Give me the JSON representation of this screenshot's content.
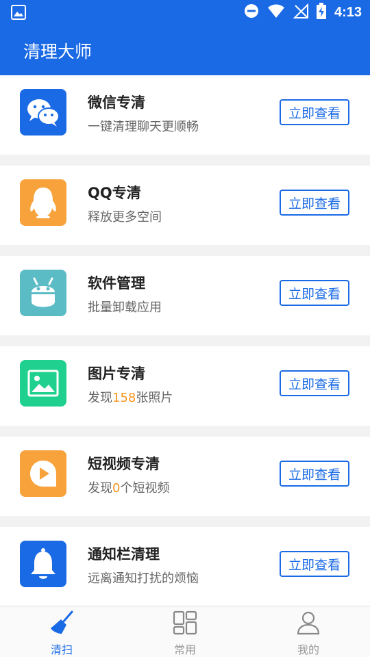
{
  "status_bar": {
    "time": "4:13"
  },
  "app": {
    "title": "清理大师"
  },
  "cards": [
    {
      "title": "微信专清",
      "sub": "一键清理聊天更顺畅",
      "button": "立即查看",
      "icon": "wechat-icon",
      "color": "#1a6ae6"
    },
    {
      "title": "QQ专清",
      "sub": "释放更多空间",
      "button": "立即查看",
      "icon": "qq-icon",
      "color": "#f7a23b"
    },
    {
      "title": "软件管理",
      "sub": "批量卸载应用",
      "button": "立即查看",
      "icon": "android-icon",
      "color": "#5bbcc6"
    },
    {
      "title": "图片专清",
      "sub_prefix": "发现",
      "sub_count": "158",
      "sub_suffix": "张照片",
      "button": "立即查看",
      "icon": "image-icon",
      "color": "#1fd08e"
    },
    {
      "title": "短视频专清",
      "sub_prefix": "发现",
      "sub_count": "0",
      "sub_suffix": "个短视频",
      "button": "立即查看",
      "icon": "video-play-icon",
      "color": "#f7a23b"
    },
    {
      "title": "通知栏清理",
      "sub": "远离通知打扰的烦恼",
      "button": "立即查看",
      "icon": "bell-icon",
      "color": "#1a6ae6"
    }
  ],
  "bottom_nav": [
    {
      "label": "清扫",
      "icon": "broom-icon",
      "active": true
    },
    {
      "label": "常用",
      "icon": "grid-icon",
      "active": false
    },
    {
      "label": "我的",
      "icon": "person-icon",
      "active": false
    }
  ],
  "colors": {
    "primary": "#1a6ae6",
    "highlight": "#f7941d"
  }
}
